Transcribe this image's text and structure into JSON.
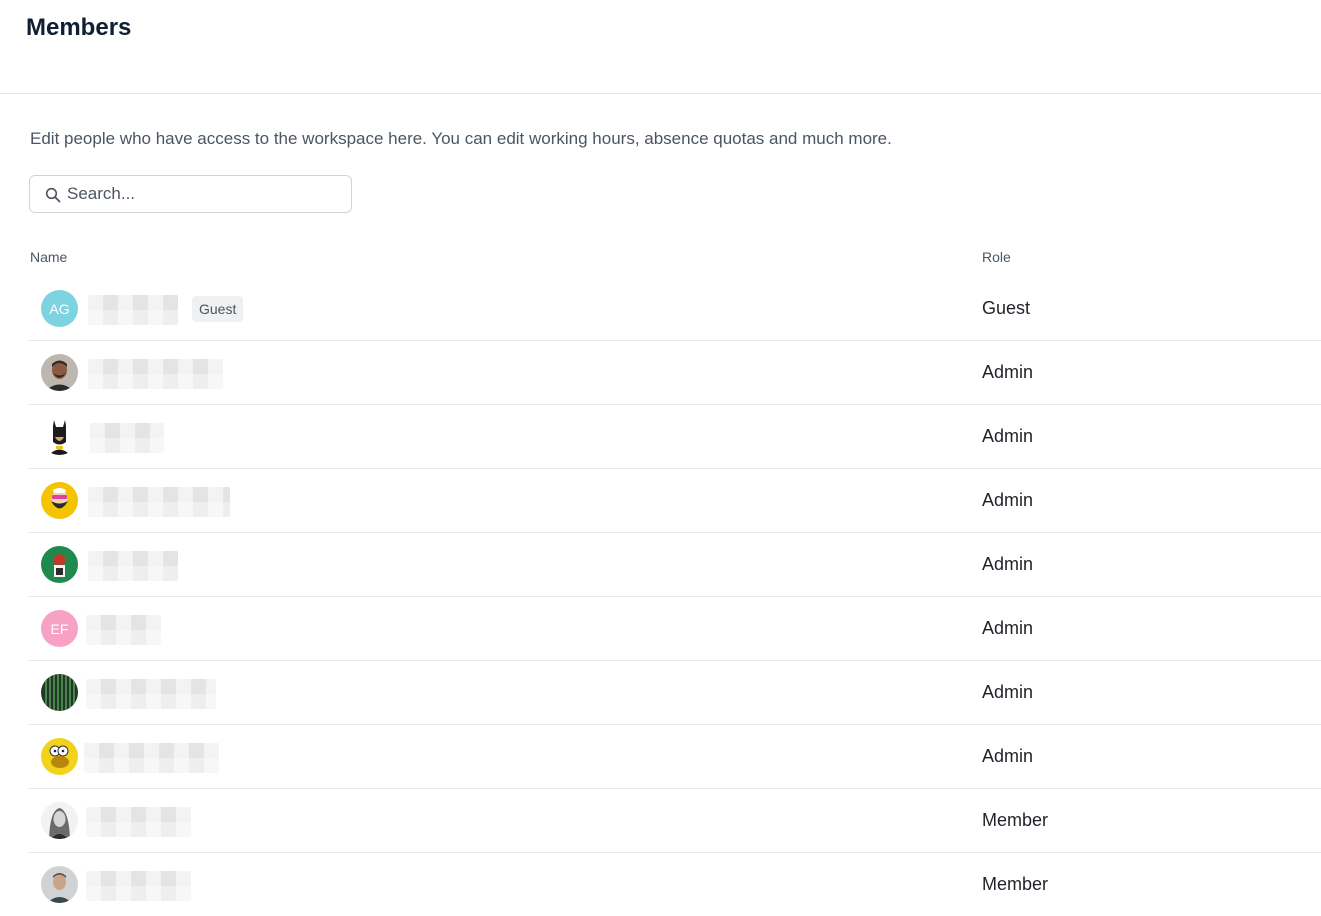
{
  "page": {
    "title": "Members"
  },
  "description": "Edit people who have access to the workspace here. You can edit working hours, absence quotas and much more.",
  "search": {
    "placeholder": "Search...",
    "value": ""
  },
  "table": {
    "columns": {
      "name": "Name",
      "role": "Role"
    },
    "rows": [
      {
        "avatar": {
          "type": "initials",
          "text": "AG",
          "color": "#7dd3e0"
        },
        "badge": "Guest",
        "role": "Guest"
      },
      {
        "avatar": {
          "type": "photo",
          "icon": "man-photo-avatar"
        },
        "role": "Admin"
      },
      {
        "avatar": {
          "type": "photo",
          "icon": "batman-avatar"
        },
        "role": "Admin"
      },
      {
        "avatar": {
          "type": "photo",
          "icon": "bearded-cartoon-avatar"
        },
        "role": "Admin"
      },
      {
        "avatar": {
          "type": "photo",
          "icon": "green-cartoon-avatar"
        },
        "role": "Admin"
      },
      {
        "avatar": {
          "type": "initials",
          "text": "EF",
          "color": "#f7a1c4"
        },
        "role": "Admin"
      },
      {
        "avatar": {
          "type": "photo",
          "icon": "matrix-pattern-avatar"
        },
        "role": "Admin"
      },
      {
        "avatar": {
          "type": "photo",
          "icon": "simpson-cartoon-avatar"
        },
        "role": "Admin"
      },
      {
        "avatar": {
          "type": "photo",
          "icon": "woman-photo-avatar"
        },
        "role": "Member"
      },
      {
        "avatar": {
          "type": "photo",
          "icon": "man-photo-avatar-2"
        },
        "role": "Member"
      }
    ]
  },
  "colors": {
    "title": "#0f1f33",
    "divider": "#e5e7eb",
    "text": "#1f2328",
    "muted": "#4b5563"
  }
}
